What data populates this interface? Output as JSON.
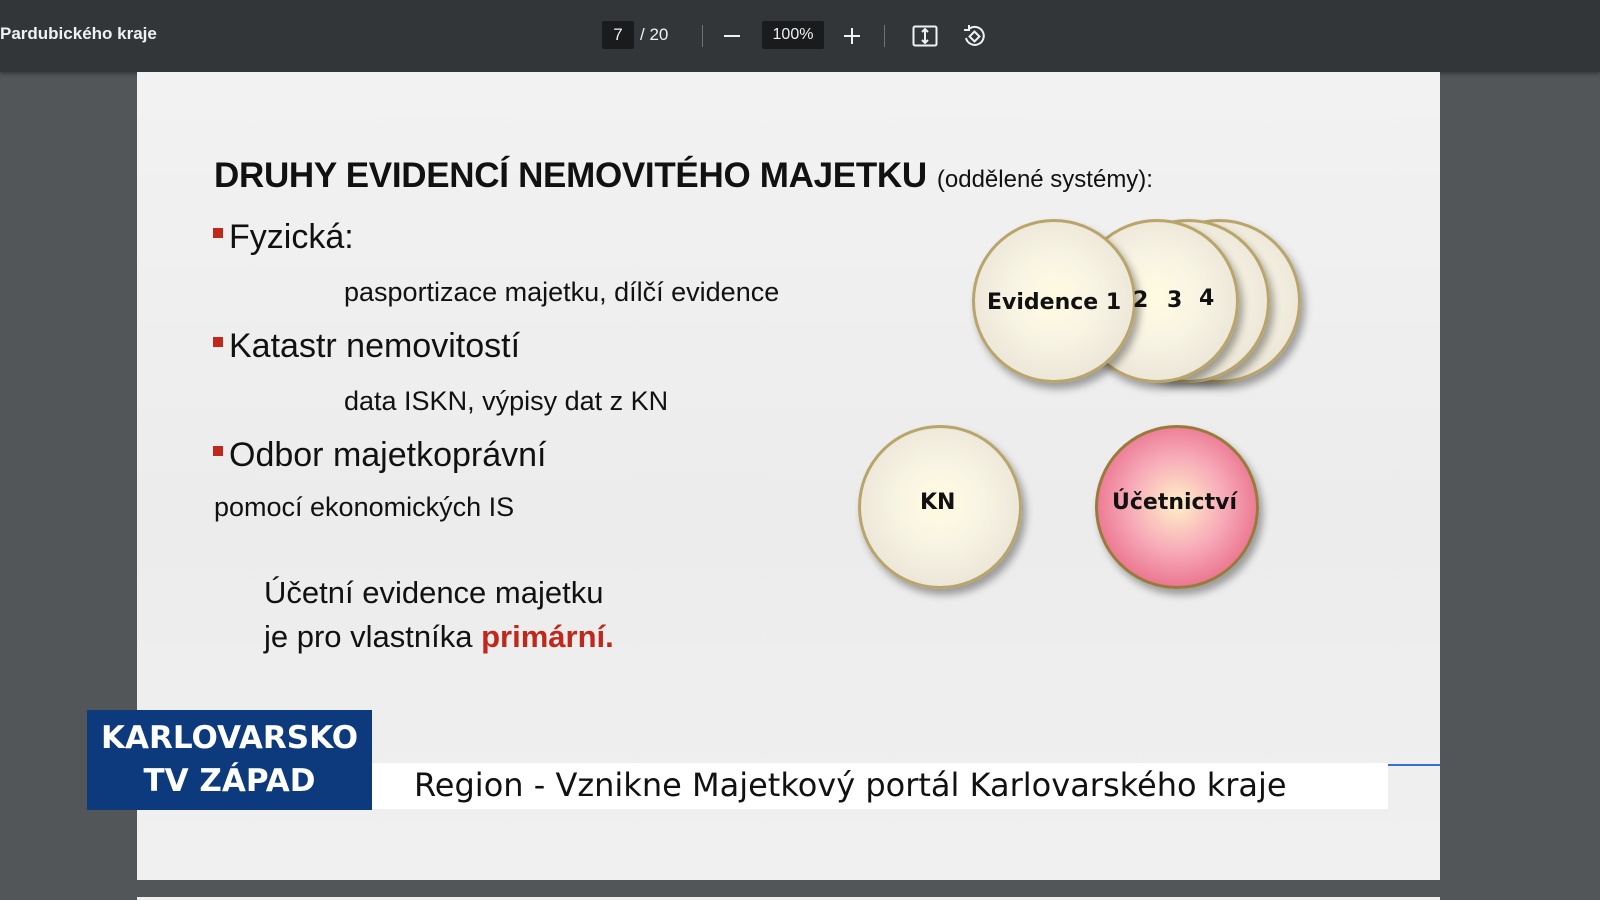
{
  "toolbar": {
    "doc_title": "Pardubického kraje",
    "current_page": "7",
    "page_total": "/ 20",
    "zoom": "100%",
    "icons": {
      "zoom_out": "minus-icon",
      "zoom_in": "plus-icon",
      "fit": "fit-to-page-icon",
      "rotate": "rotate-icon"
    }
  },
  "slide": {
    "title": "DRUHY EVIDENCÍ NEMOVITÉHO MAJETKU",
    "title_sub": "(oddělené systémy):",
    "bullets": [
      {
        "label": "Fyzická:",
        "detail": "pasportizace majetku, dílčí evidence"
      },
      {
        "label": "Katastr nemovitostí",
        "detail": "data ISKN, výpisy dat z KN"
      },
      {
        "label": "Odbor majetkoprávní",
        "detail": "pomocí ekonomických IS"
      }
    ],
    "primary_line1": "Účetní evidence majetku",
    "primary_line2_prefix": "je pro vlastníka",
    "primary_line2_highlight": "primární.",
    "circles": {
      "evidence1": "Evidence 1",
      "evidence2": "2",
      "evidence3": "3",
      "evidence4": "4",
      "kn": "KN",
      "ucetnictvi": "Účetnictví"
    },
    "colors": {
      "bullet_red": "#c0281c",
      "pink_circle": "#e96e8a"
    }
  },
  "overlay": {
    "logo_line1": "KARLOVARSKO",
    "logo_line2": "TV ZÁPAD",
    "headline": "Region - Vznikne Majetkový portál Karlovarského kraje",
    "logo_color": "#0d3a7d"
  }
}
